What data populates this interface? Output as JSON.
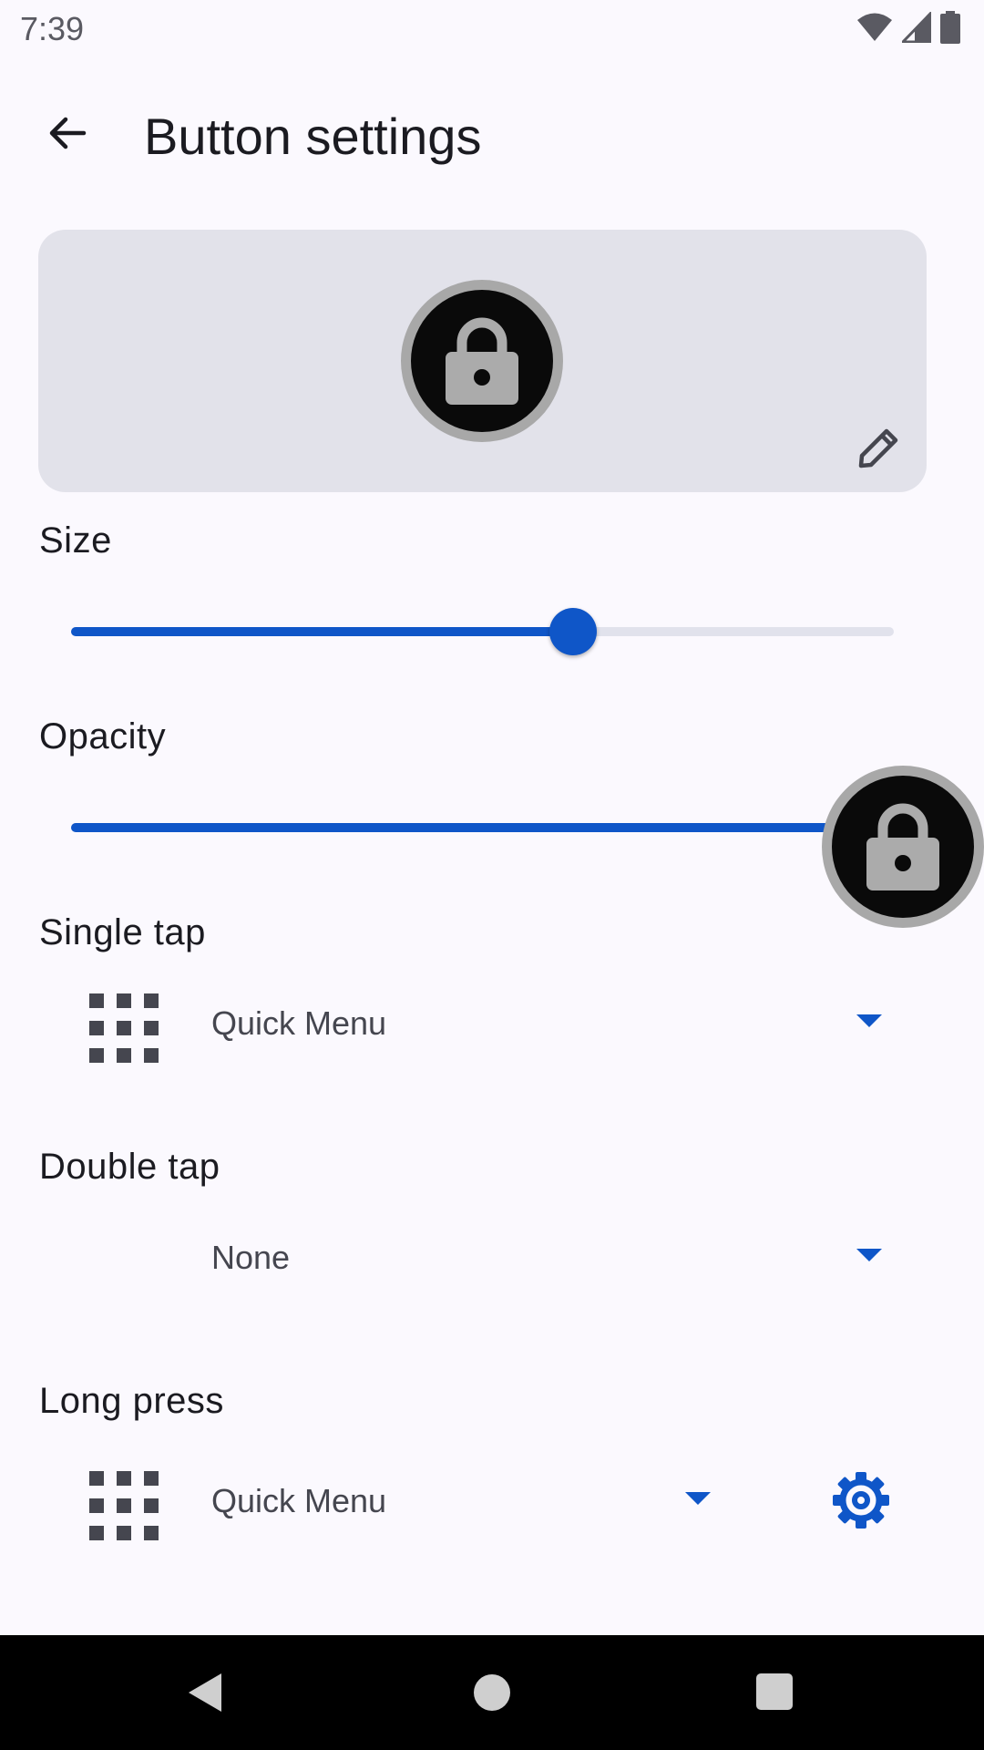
{
  "status_bar": {
    "time": "7:39",
    "icons": [
      "wifi-icon",
      "signal-icon",
      "battery-icon"
    ]
  },
  "app_bar": {
    "title": "Button settings",
    "back_icon": "arrow-back-icon"
  },
  "preview": {
    "button_icon": "lock-icon",
    "edit_icon": "pencil-icon"
  },
  "size": {
    "label": "Size",
    "value_fraction": 0.61
  },
  "opacity": {
    "label": "Opacity",
    "value_fraction": 1.0
  },
  "single_tap": {
    "label": "Single tap",
    "value": "Quick Menu",
    "icon": "grid-icon"
  },
  "double_tap": {
    "label": "Double tap",
    "value": "None"
  },
  "long_press": {
    "label": "Long press",
    "value": "Quick Menu",
    "icon": "grid-icon",
    "settings_icon": "gear-icon"
  },
  "colors": {
    "accent": "#0f56c8",
    "background": "#fbf9fe",
    "card": "#e2e2ea",
    "icon_dark": "#45464f"
  }
}
